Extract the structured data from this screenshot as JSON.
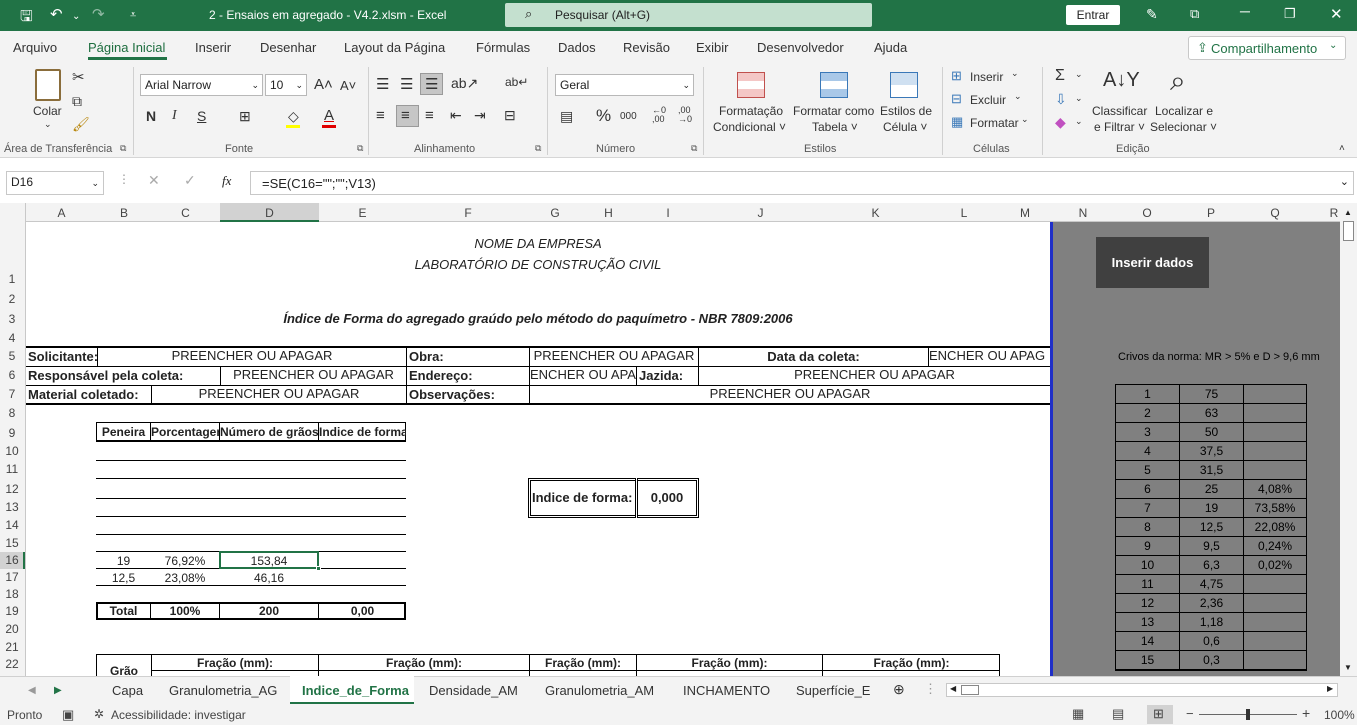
{
  "window": {
    "title": "2 - Ensaios em agregado - V4.2.xlsm  -  Excel",
    "search": "Pesquisar (Alt+G)",
    "signin": "Entrar"
  },
  "menu": [
    "Arquivo",
    "Página Inicial",
    "Inserir",
    "Desenhar",
    "Layout da Página",
    "Fórmulas",
    "Dados",
    "Revisão",
    "Exibir",
    "Desenvolvedor",
    "Ajuda"
  ],
  "share": "Compartilhamento",
  "ribbon": {
    "paste": "Colar",
    "font": "Arial Narrow",
    "size": "10",
    "bold": "N",
    "italic": "I",
    "underline": "S",
    "number_format": "Geral",
    "cond_format": [
      "Formatação",
      "Condicional ˅"
    ],
    "format_table": [
      "Formatar como",
      "Tabela ˅"
    ],
    "cell_styles": [
      "Estilos de",
      "Célula ˅"
    ],
    "insert": "Inserir",
    "delete": "Excluir",
    "format": "Formatar",
    "sort": [
      "Classificar",
      "e Filtrar ˅"
    ],
    "find": [
      "Localizar e",
      "Selecionar ˅"
    ],
    "groups": [
      "Área de Transferência",
      "Fonte",
      "Alinhamento",
      "Número",
      "Estilos",
      "Células",
      "Edição"
    ]
  },
  "formula_bar": {
    "cell": "D16",
    "fx": "fx",
    "formula": "=SE(C16=\"\";\"\";V13)"
  },
  "columns": [
    "A",
    "B",
    "C",
    "D",
    "E",
    "F",
    "G",
    "H",
    "I",
    "J",
    "K",
    "L",
    "M",
    "N",
    "O",
    "P",
    "Q",
    "R"
  ],
  "rows": [
    "1",
    "2",
    "3",
    "4",
    "5",
    "6",
    "7",
    "8",
    "9",
    "10",
    "11",
    "12",
    "13",
    "14",
    "15",
    "16",
    "17",
    "18",
    "19",
    "20",
    "21",
    "22"
  ],
  "doc": {
    "company": "NOME DA EMPRESA",
    "lab": "LABORATÓRIO DE CONSTRUÇÃO CIVIL",
    "title": "Índice de Forma do agregado graúdo pelo método do paquímetro - NBR 7809:2006",
    "solicitante": "Solicitante:",
    "obra": "Obra:",
    "data_coleta": "Data da coleta:",
    "responsavel": "Responsável pela coleta:",
    "endereco": "Endereço:",
    "jazida": "Jazida:",
    "material": "Material coletado:",
    "observacoes": "Observações:",
    "fill": "PREENCHER OU APAGAR",
    "fill_cut": "ENCHER OU APAG",
    "fill_cut2": "ENCHER OU APA",
    "th": [
      "Peneira",
      "Porcentagem",
      "Número de grãos",
      "Indice de forma"
    ],
    "r16": [
      "19",
      "76,92%",
      "153,84",
      ""
    ],
    "r17": [
      "12,5",
      "23,08%",
      "46,16",
      ""
    ],
    "total": [
      "Total",
      "100%",
      "200",
      "0,00"
    ],
    "indice_label": "Indice de forma:",
    "indice_value": "0,000",
    "grao": "Grão",
    "fracao": "Fração (mm):"
  },
  "side": {
    "button": "Inserir dados",
    "note": "Crivos da norma: MR > 5% e D > 9,6 mm",
    "table": [
      [
        "1",
        "75",
        ""
      ],
      [
        "2",
        "63",
        ""
      ],
      [
        "3",
        "50",
        ""
      ],
      [
        "4",
        "37,5",
        ""
      ],
      [
        "5",
        "31,5",
        ""
      ],
      [
        "6",
        "25",
        "4,08%"
      ],
      [
        "7",
        "19",
        "73,58%"
      ],
      [
        "8",
        "12,5",
        "22,08%"
      ],
      [
        "9",
        "9,5",
        "0,24%"
      ],
      [
        "10",
        "6,3",
        "0,02%"
      ],
      [
        "11",
        "4,75",
        ""
      ],
      [
        "12",
        "2,36",
        ""
      ],
      [
        "13",
        "1,18",
        ""
      ],
      [
        "14",
        "0,6",
        ""
      ],
      [
        "15",
        "0,3",
        ""
      ]
    ]
  },
  "sheets": [
    "Capa",
    "Granulometria_AG",
    "Indice_de_Forma",
    "Densidade_AM",
    "Granulometria_AM",
    "INCHAMENTO",
    "Superfície_E"
  ],
  "status": {
    "ready": "Pronto",
    "access": "Acessibilidade: investigar",
    "zoom": "100%"
  }
}
